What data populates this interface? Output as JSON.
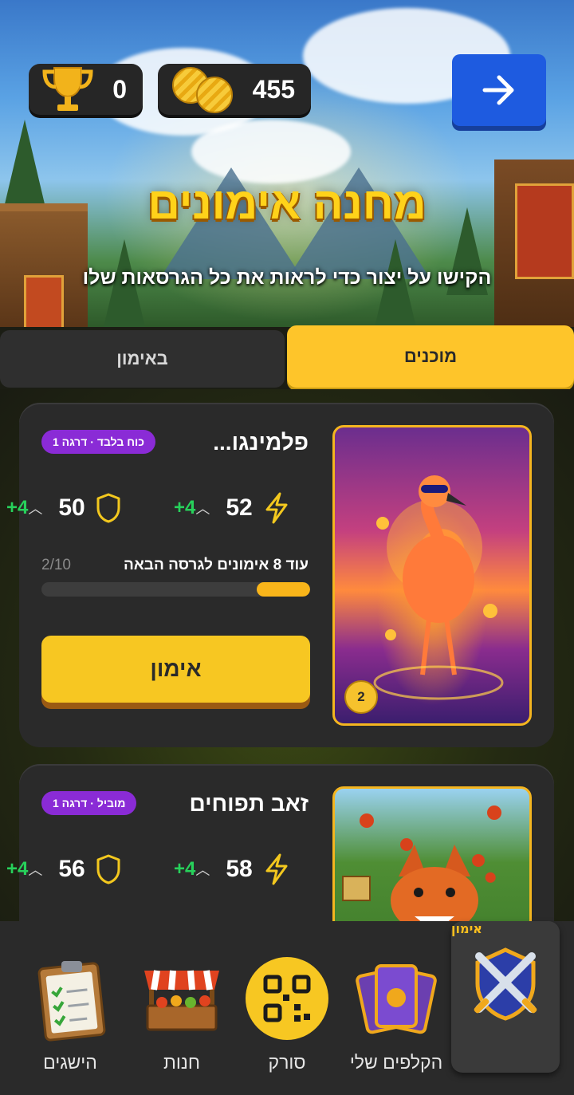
{
  "header": {
    "trophies": "0",
    "coins": "455",
    "title": "מחנה אימונים",
    "subtitle": "הקישו על יצור כדי לראות את כל הגרסאות שלו",
    "nav_icon": "arrow-right-icon"
  },
  "tabs": [
    {
      "label": "מוכנים",
      "active": true
    },
    {
      "label": "באימון",
      "active": false
    }
  ],
  "cards": [
    {
      "name": "פלמינגו...",
      "rank": "כוח בלבד · דרגה 1",
      "power": "52",
      "power_plus": "+4",
      "defense": "50",
      "defense_plus": "+4",
      "progress_label": "עוד 8 אימונים לגרסה הבאה",
      "progress_count": "2/10",
      "progress_fraction": 0.2,
      "button": "אימון",
      "art_badge": "2"
    },
    {
      "name": "זאב תפוחים",
      "rank": "מוביל · דרגה 1",
      "power": "58",
      "power_plus": "+4",
      "defense": "56",
      "defense_plus": "+4"
    }
  ],
  "bottom_nav": [
    {
      "label": "אימון",
      "icon": "crossed-swords-icon",
      "active": true
    },
    {
      "label": "הקלפים שלי",
      "icon": "cards-icon",
      "active": false
    },
    {
      "label": "סורק",
      "icon": "qr-code-icon",
      "active": false
    },
    {
      "label": "חנות",
      "icon": "shop-stall-icon",
      "active": false
    },
    {
      "label": "הישגים",
      "icon": "clipboard-icon",
      "active": false
    }
  ],
  "colors": {
    "accent_yellow": "#fec52a",
    "rank_purple": "#8a2bd6",
    "plus_green": "#27d15b",
    "nav_blue": "#1e5be0"
  }
}
